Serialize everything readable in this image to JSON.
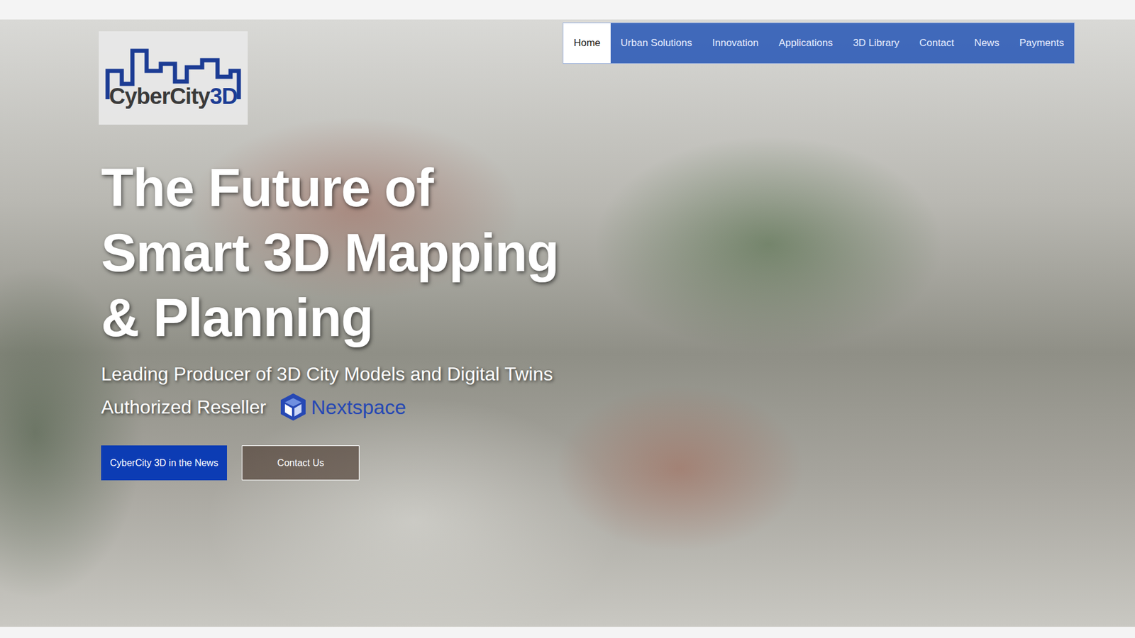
{
  "logo": {
    "text": "CyberCity",
    "accent": "3D"
  },
  "nav": [
    {
      "label": "Home",
      "selected": true
    },
    {
      "label": "Urban Solutions",
      "selected": false
    },
    {
      "label": "Innovation",
      "selected": false
    },
    {
      "label": "Applications",
      "selected": false
    },
    {
      "label": "3D Library",
      "selected": false
    },
    {
      "label": "Contact",
      "selected": false
    },
    {
      "label": "News",
      "selected": false
    },
    {
      "label": "Payments",
      "selected": false
    }
  ],
  "hero": {
    "title_lines": [
      "The Future of",
      "Smart 3D Mapping",
      "& Planning"
    ],
    "subtitle": "Leading Producer of 3D City Models and Digital Twins",
    "reseller": "Authorized Reseller",
    "partner": "Nextspace"
  },
  "buttons": [
    {
      "label": "CyberCity 3D in the News",
      "kind": "primary"
    },
    {
      "label": "Contact Us",
      "kind": "outline"
    }
  ]
}
